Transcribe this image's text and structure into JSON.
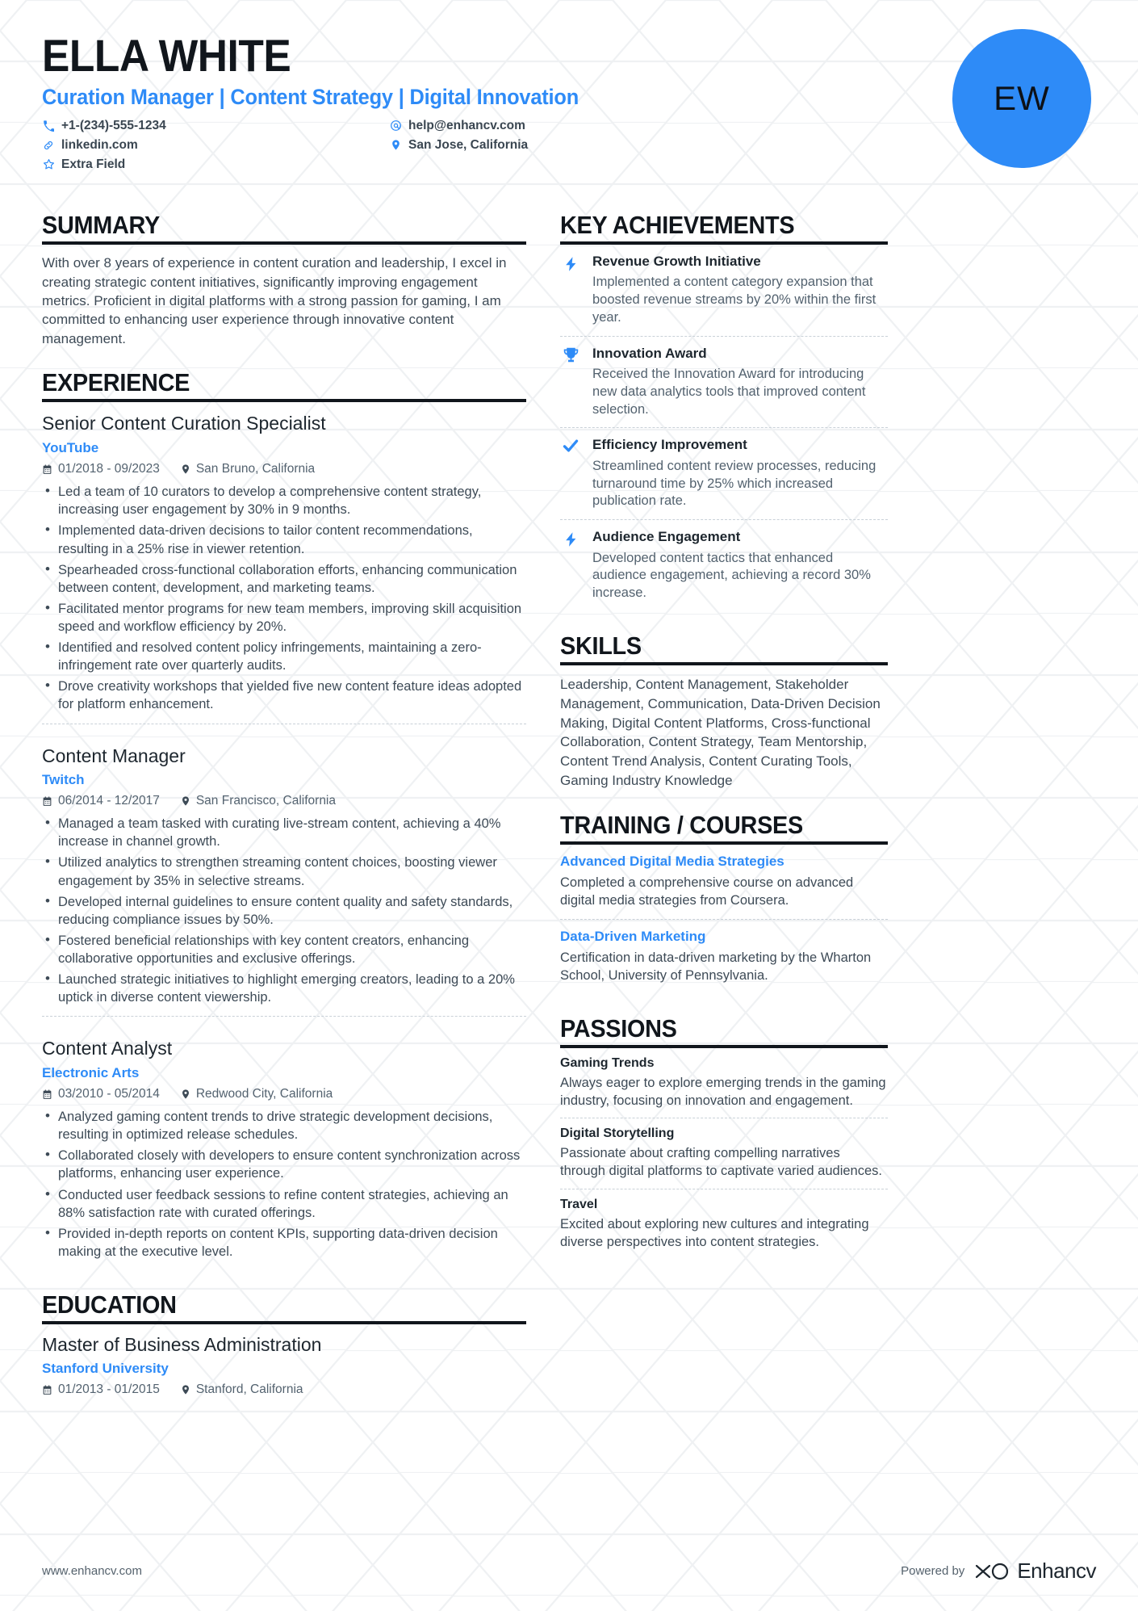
{
  "accent_color": "#2e8bf7",
  "header": {
    "name": "ELLA WHITE",
    "role": "Curation Manager | Content Strategy | Digital Innovation",
    "avatar_initials": "EW",
    "contacts": [
      {
        "icon": "phone-icon",
        "glyph": "✆",
        "text": "+1-(234)-555-1234"
      },
      {
        "icon": "email-icon",
        "glyph": "@",
        "text": "help@enhancv.com"
      },
      {
        "icon": "link-icon",
        "glyph": "ὑ7",
        "text": "linkedin.com"
      },
      {
        "icon": "location-icon",
        "glyph": "•",
        "text": "San Jose, California"
      },
      {
        "icon": "star-icon",
        "glyph": "☆",
        "text": "Extra Field"
      }
    ]
  },
  "summary": {
    "heading": "SUMMARY",
    "text": "With over 8 years of experience in content curation and leadership, I excel in creating strategic content initiatives, significantly improving engagement metrics. Proficient in digital platforms with a strong passion for gaming, I am committed to enhancing user experience through innovative content management."
  },
  "experience": {
    "heading": "EXPERIENCE",
    "jobs": [
      {
        "title": "Senior Content Curation Specialist",
        "company": "YouTube",
        "dates": "01/2018 - 09/2023",
        "location": "San Bruno, California",
        "bullets": [
          "Led a team of 10 curators to develop a comprehensive content strategy, increasing user engagement by 30% in 9 months.",
          "Implemented data-driven decisions to tailor content recommendations, resulting in a 25% rise in viewer retention.",
          "Spearheaded cross-functional collaboration efforts, enhancing communication between content, development, and marketing teams.",
          "Facilitated mentor programs for new team members, improving skill acquisition speed and workflow efficiency by 20%.",
          "Identified and resolved content policy infringements, maintaining a zero-infringement rate over quarterly audits.",
          "Drove creativity workshops that yielded five new content feature ideas adopted for platform enhancement."
        ]
      },
      {
        "title": "Content Manager",
        "company": "Twitch",
        "dates": "06/2014 - 12/2017",
        "location": "San Francisco, California",
        "bullets": [
          "Managed a team tasked with curating live-stream content, achieving a 40% increase in channel growth.",
          "Utilized analytics to strengthen streaming content choices, boosting viewer engagement by 35% in selective streams.",
          "Developed internal guidelines to ensure content quality and safety standards, reducing compliance issues by 50%.",
          "Fostered beneficial relationships with key content creators, enhancing collaborative opportunities and exclusive offerings.",
          "Launched strategic initiatives to highlight emerging creators, leading to a 20% uptick in diverse content viewership."
        ]
      },
      {
        "title": "Content Analyst",
        "company": "Electronic Arts",
        "dates": "03/2010 - 05/2014",
        "location": "Redwood City, California",
        "bullets": [
          "Analyzed gaming content trends to drive strategic development decisions, resulting in optimized release schedules.",
          "Collaborated closely with developers to ensure content synchronization across platforms, enhancing user experience.",
          "Conducted user feedback sessions to refine content strategies, achieving an 88% satisfaction rate with curated offerings.",
          "Provided in-depth reports on content KPIs, supporting data-driven decision making at the executive level."
        ]
      }
    ]
  },
  "education": {
    "heading": "EDUCATION",
    "entries": [
      {
        "degree": "Master of Business Administration",
        "school": "Stanford University",
        "dates": "01/2013 - 01/2015",
        "location": "Stanford, California"
      }
    ]
  },
  "achievements": {
    "heading": "KEY ACHIEVEMENTS",
    "items": [
      {
        "icon": "lightning-bolt-icon",
        "glyph": "⚡",
        "title": "Revenue Growth Initiative",
        "description": "Implemented a content category expansion that boosted revenue streams by 20% within the first year."
      },
      {
        "icon": "trophy-icon",
        "glyph": "🏆",
        "title": "Innovation Award",
        "description": "Received the Innovation Award for introducing new data analytics tools that improved content selection."
      },
      {
        "icon": "checkmark-icon",
        "glyph": "✔",
        "title": "Efficiency Improvement",
        "description": "Streamlined content review processes, reducing turnaround time by 25% which increased publication rate."
      },
      {
        "icon": "lightning-bolt-icon",
        "glyph": "⚡",
        "title": "Audience Engagement",
        "description": "Developed content tactics that enhanced audience engagement, achieving a record 30% increase."
      }
    ]
  },
  "skills": {
    "heading": "SKILLS",
    "text": "Leadership, Content Management, Stakeholder Management, Communication, Data-Driven Decision Making, Digital Content Platforms, Cross-functional Collaboration, Content Strategy, Team Mentorship, Content Trend Analysis, Content Curating Tools, Gaming Industry Knowledge"
  },
  "training": {
    "heading": "TRAINING / COURSES",
    "items": [
      {
        "title": "Advanced Digital Media Strategies",
        "description": "Completed a comprehensive course on advanced digital media strategies from Coursera."
      },
      {
        "title": "Data-Driven Marketing",
        "description": "Certification in data-driven marketing by the Wharton School, University of Pennsylvania."
      }
    ]
  },
  "passions": {
    "heading": "PASSIONS",
    "items": [
      {
        "title": "Gaming Trends",
        "description": "Always eager to explore emerging trends in the gaming industry, focusing on innovation and engagement."
      },
      {
        "title": "Digital Storytelling",
        "description": "Passionate about crafting compelling narratives through digital platforms to captivate varied audiences."
      },
      {
        "title": "Travel",
        "description": "Excited about exploring new cultures and integrating diverse perspectives into content strategies."
      }
    ]
  },
  "footer": {
    "website": "www.enhancv.com",
    "powered_by": "Powered by",
    "brand": "Enhancv"
  }
}
